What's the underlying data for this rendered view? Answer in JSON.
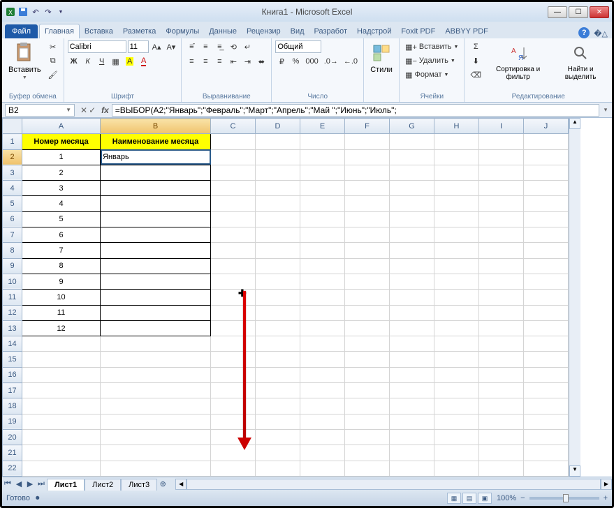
{
  "titlebar": {
    "title": "Книга1  -  Microsoft Excel"
  },
  "tabs": {
    "file": "Файл",
    "items": [
      "Главная",
      "Вставка",
      "Разметка",
      "Формулы",
      "Данные",
      "Рецензир",
      "Вид",
      "Разработ",
      "Надстрой",
      "Foxit PDF",
      "ABBYY PDF"
    ],
    "active_index": 0
  },
  "ribbon": {
    "clipboard": {
      "paste": "Вставить",
      "label": "Буфер обмена"
    },
    "font": {
      "name": "Calibri",
      "size": "11",
      "label": "Шрифт",
      "bold": "Ж",
      "italic": "К",
      "underline": "Ч"
    },
    "alignment": {
      "label": "Выравнивание"
    },
    "number": {
      "format": "Общий",
      "label": "Число"
    },
    "styles": {
      "btn": "Стили"
    },
    "cells": {
      "insert": "Вставить",
      "delete": "Удалить",
      "format": "Формат",
      "label": "Ячейки"
    },
    "editing": {
      "sort": "Сортировка и фильтр",
      "find": "Найти и выделить",
      "label": "Редактирование"
    }
  },
  "formula_bar": {
    "name_box": "B2",
    "fx": "fx",
    "formula": "=ВЫБОР(A2;\"Январь\";\"Февраль\";\"Март\";\"Апрель\";\"Май \";\"Июнь\";\"Июль\";"
  },
  "grid": {
    "columns": [
      "A",
      "B",
      "C",
      "D",
      "E",
      "F",
      "G",
      "H",
      "I",
      "J"
    ],
    "headers": {
      "A": "Номер месяца",
      "B": "Наименование месяца"
    },
    "rows": [
      {
        "n": "1"
      },
      {
        "n": "2",
        "A": "1",
        "B": "Январь"
      },
      {
        "n": "3",
        "A": "2"
      },
      {
        "n": "4",
        "A": "3"
      },
      {
        "n": "5",
        "A": "4"
      },
      {
        "n": "6",
        "A": "5"
      },
      {
        "n": "7",
        "A": "6"
      },
      {
        "n": "8",
        "A": "7"
      },
      {
        "n": "9",
        "A": "8"
      },
      {
        "n": "10",
        "A": "9"
      },
      {
        "n": "11",
        "A": "10"
      },
      {
        "n": "12",
        "A": "11"
      },
      {
        "n": "13",
        "A": "12"
      },
      {
        "n": "14"
      },
      {
        "n": "15"
      },
      {
        "n": "16"
      },
      {
        "n": "17"
      },
      {
        "n": "18"
      },
      {
        "n": "19"
      },
      {
        "n": "20"
      },
      {
        "n": "21"
      },
      {
        "n": "22"
      }
    ],
    "selected_cell": "B2"
  },
  "sheets": {
    "items": [
      "Лист1",
      "Лист2",
      "Лист3"
    ],
    "active_index": 0
  },
  "status": {
    "ready": "Готово",
    "zoom": "100%",
    "minus": "−",
    "plus": "+"
  }
}
